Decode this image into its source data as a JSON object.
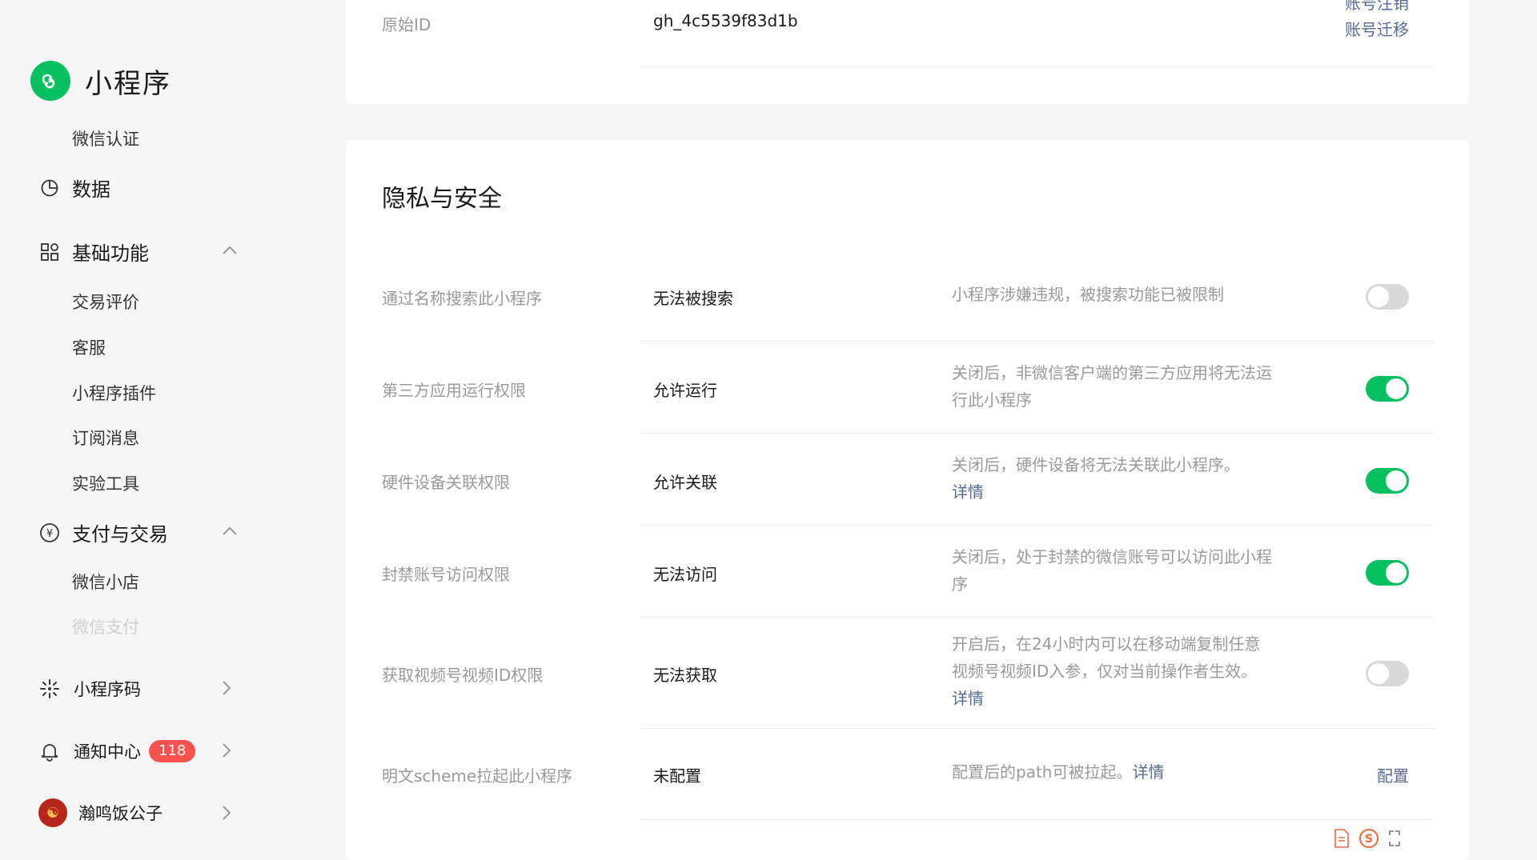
{
  "sidebar": {
    "brand_title": "小程序",
    "items": {
      "wechat_cert": "微信认证",
      "data": "数据",
      "basic": "基础功能",
      "trade_review": "交易评价",
      "customer_service": "客服",
      "plugins": "小程序插件",
      "subscribe_msg": "订阅消息",
      "lab_tools": "实验工具",
      "pay_trade": "支付与交易",
      "wechat_store": "微信小店",
      "wechat_pay": "微信支付",
      "mini_code": "小程序码",
      "notify_center": "通知中心",
      "notify_count": "118",
      "user_name": "瀚鸣饭公子"
    }
  },
  "account_card": {
    "original_id_label": "原始ID",
    "original_id_value": "gh_4c5539f83d1b",
    "cancel_link": "账号注销",
    "migrate_link": "账号迁移"
  },
  "privacy": {
    "title": "隐私与安全",
    "rows": [
      {
        "label": "通过名称搜索此小程序",
        "value": "无法被搜索",
        "desc": "小程序涉嫌违规，被搜索功能已被限制",
        "toggle": "off"
      },
      {
        "label": "第三方应用运行权限",
        "value": "允许运行",
        "desc": "关闭后，非微信客户端的第三方应用将无法运行此小程序",
        "toggle": "on"
      },
      {
        "label": "硬件设备关联权限",
        "value": "允许关联",
        "desc": "关闭后，硬件设备将无法关联此小程序。",
        "link": "详情",
        "toggle": "on"
      },
      {
        "label": "封禁账号访问权限",
        "value": "无法访问",
        "desc": "关闭后，处于封禁的微信账号可以访问此小程序",
        "toggle": "on"
      },
      {
        "label": "获取视频号视频ID权限",
        "value": "无法获取",
        "desc": "开启后，在24小时内可以在移动端复制任意视频号视频ID入参，仅对当前操作者生效。",
        "link": "详情",
        "toggle": "off"
      },
      {
        "label": "明文scheme拉起此小程序",
        "value": "未配置",
        "desc": "配置后的path可被拉起。",
        "link": "详情",
        "action": "配置"
      }
    ]
  },
  "colors": {
    "accent": "#07c160",
    "link": "#576b95",
    "badge": "#fa5151"
  }
}
